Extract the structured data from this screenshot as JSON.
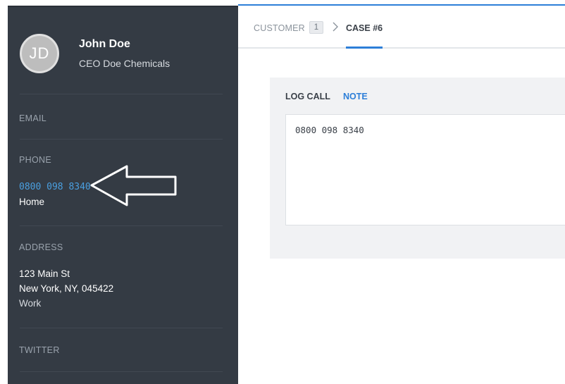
{
  "contact": {
    "initials": "JD",
    "name": "John Doe",
    "title": "CEO Doe Chemicals"
  },
  "sections": {
    "email_label": "EMAIL",
    "phone_label": "PHONE",
    "address_label": "ADDRESS",
    "twitter_label": "TWITTER"
  },
  "phone": {
    "number": "0800 098 8340",
    "type": "Home"
  },
  "address": {
    "street": "123 Main St",
    "city_line": "New York, NY, 045422",
    "type": "Work"
  },
  "breadcrumb": {
    "customer_label": "CUSTOMER",
    "customer_count": "1",
    "case_label": "CASE #6"
  },
  "composer": {
    "tabs": [
      "LOG CALL",
      "NOTE"
    ],
    "active_tab": "NOTE",
    "note_value": "0800 098 8340"
  },
  "colors": {
    "sidebar_bg": "#343b44",
    "accent": "#2d7fd8",
    "link": "#4a9fe0"
  },
  "icons": [
    "chevron-right-icon",
    "arrow-left-annotation"
  ]
}
